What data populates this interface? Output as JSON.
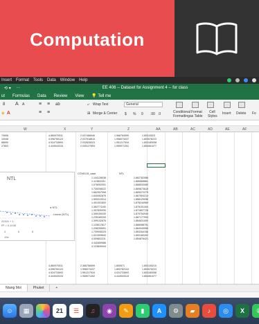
{
  "banner": {
    "title": "Computation",
    "left_color": "#e84c4f",
    "right_color": "#333333",
    "icon": "open-book-icon"
  },
  "menubar": {
    "items": [
      "Insert",
      "Format",
      "Tools",
      "Data",
      "Window",
      "Help"
    ]
  },
  "titlebar": {
    "title": "EE 406 -- Dataset for Assignment 4 -- for class",
    "undo_label": "⟲ ▾",
    "more_label": "···"
  },
  "ribbon_tabs": [
    "ut",
    "Formulas",
    "Data",
    "Review",
    "View",
    "Tell me"
  ],
  "ribbon": {
    "font_size": "8",
    "font_grow": "A",
    "font_shrink": "A",
    "wrap_text": "Wrap Text",
    "number_format": "General",
    "merge_center": "Merge & Center",
    "currency": "$",
    "percent": "%",
    "comma": "9",
    "dec_inc": ".00",
    "dec_dec": ".0",
    "conditional_formatting_1": "Conditional",
    "conditional_formatting_2": "Formatting",
    "format_table_1": "Format",
    "format_table_2": "as Table",
    "cell_styles_1": "Cell",
    "cell_styles_2": "Styles",
    "insert": "Insert",
    "delete": "Delete",
    "format": "Fo"
  },
  "columns": [
    "W",
    "X",
    "Y",
    "Z",
    "AA",
    "AB",
    "AC",
    "AD",
    "AE",
    "AF"
  ],
  "sheet": {
    "block_top": [
      [
        "70606",
        "4.860970511",
        "2.037486946",
        "1.966764599",
        "1.80310523"
      ],
      [
        "10048",
        "4.096760124",
        "2.037918815",
        "1.958073437",
        "1.803076223"
      ],
      [
        "86690",
        "4.924733693",
        "2.032828323",
        "1.951217534",
        "1.803180058"
      ],
      [
        "27803",
        "4.444943315",
        "2.035127893",
        "1.955971302",
        "1.854061077"
      ]
    ],
    "covid_header": "COVID19_case",
    "ntl_header": "NTL",
    "covid_values": [
      "1.144128036",
      "1.113603311",
      "1.078092091",
      "1.739206022",
      "1.662957998",
      "1.645452876",
      "1.505313314",
      "1.491301600",
      "1.382771180",
      "1.357830030",
      "1.399159330",
      "1.235169209",
      "1.399132676",
      "1.125617817",
      "1.208255991",
      "1.739906225",
      "1.021909640",
      "4.009802211",
      "4.442659586",
      "4.123849444"
    ],
    "ntl_values": [
      "1.862782086",
      "1.866568861",
      "1.868533080",
      "1.869873618",
      "1.869372279",
      "1.867904214",
      "1.868129096",
      "1.878244969",
      "1.876151304",
      "1.871807728",
      "1.870754945",
      "1.867177994",
      "1.864631000",
      "1.868088751",
      "1.864949956",
      "1.853264156",
      "1.800180402",
      "1.854876421"
    ],
    "block_bottom": [
      [
        "4.860970511",
        "2.366756599",
        "1.800571",
        "1.803105210"
      ],
      [
        "4.096760124",
        "1.958073437",
        "1.800762118",
        "1.803076223"
      ],
      [
        "4.924733693",
        "1.951217534",
        "4.024733693",
        "1.803180058"
      ],
      [
        "4.444943315",
        "1.955971302",
        "4.444943315",
        "1.854061077"
      ]
    ]
  },
  "chart": {
    "title": "NTL",
    "legend": [
      "NTL",
      "Linear (NTL)"
    ],
    "equation_1": "2042x + 1.",
    "equation_2": "R² = 0.1049",
    "x_ticks": [
      "4",
      "6",
      "8"
    ],
    "x_axis_label": "19e",
    "series_color": "#4472c4"
  },
  "sheet_tabs": [
    "Ntang Moi",
    "Phuket",
    "+"
  ],
  "dock": {
    "icons": [
      "finder-icon",
      "launchpad-icon",
      "photos-icon",
      "calendar-icon",
      "reminders-icon",
      "music-icon",
      "podcasts-icon",
      "pages-icon",
      "numbers-icon",
      "app-store-icon",
      "settings-icon",
      "keynote-icon",
      "music-red-icon",
      "safari-icon",
      "excel-icon",
      "messages-icon"
    ],
    "calendar_day": "21"
  }
}
